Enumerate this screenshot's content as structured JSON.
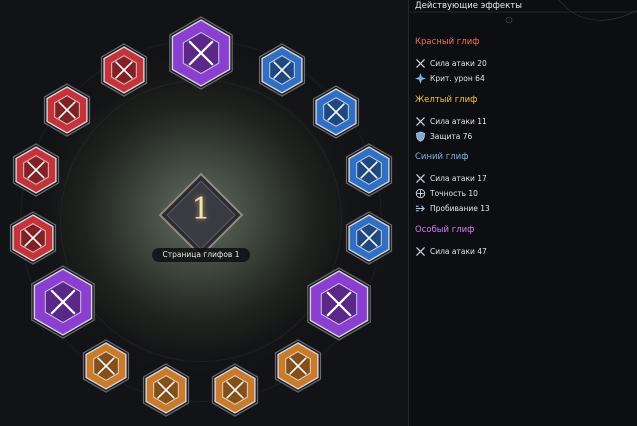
{
  "board": {
    "page_number": "1",
    "page_label": "Страница глифов 1",
    "glyphs": [
      {
        "name": "glyph-special-top",
        "color": "purple"
      },
      {
        "name": "glyph-blue-1",
        "color": "blue"
      },
      {
        "name": "glyph-blue-2",
        "color": "blue"
      },
      {
        "name": "glyph-blue-3",
        "color": "blue"
      },
      {
        "name": "glyph-blue-4",
        "color": "blue"
      },
      {
        "name": "glyph-special-right",
        "color": "purple"
      },
      {
        "name": "glyph-orange-1",
        "color": "orange"
      },
      {
        "name": "glyph-orange-2",
        "color": "orange"
      },
      {
        "name": "glyph-orange-3",
        "color": "orange"
      },
      {
        "name": "glyph-orange-4",
        "color": "orange"
      },
      {
        "name": "glyph-special-left",
        "color": "purple"
      },
      {
        "name": "glyph-red-1",
        "color": "red"
      },
      {
        "name": "glyph-red-2",
        "color": "red"
      },
      {
        "name": "glyph-red-3",
        "color": "red"
      },
      {
        "name": "glyph-red-4",
        "color": "red"
      }
    ],
    "colors": {
      "purple": "#8a3fd1",
      "blue": "#2f6fc4",
      "red": "#c4333a",
      "orange": "#c97a2a"
    }
  },
  "panel": {
    "title": "Действующие эффекты",
    "sections": [
      {
        "title": "Красный глиф",
        "color": "#f0705a",
        "stats": [
          {
            "icon": "swords-icon",
            "text": "Сила атаки 20"
          },
          {
            "icon": "crit-icon",
            "text": "Крит. урон 64"
          }
        ]
      },
      {
        "title": "Желтый глиф",
        "color": "#f2c44a",
        "stats": [
          {
            "icon": "swords-icon",
            "text": "Сила атаки 11"
          },
          {
            "icon": "shield-icon",
            "text": "Защита 76"
          }
        ]
      },
      {
        "title": "Синий глиф",
        "color": "#7fb0f0",
        "stats": [
          {
            "icon": "swords-icon",
            "text": "Сила атаки 17"
          },
          {
            "icon": "accuracy-icon",
            "text": "Точность 10"
          },
          {
            "icon": "penetration-icon",
            "text": "Пробивание 13"
          }
        ]
      },
      {
        "title": "Особый глиф",
        "color": "#d77cf2",
        "stats": [
          {
            "icon": "swords-icon",
            "text": "Сила атаки 47"
          }
        ]
      }
    ]
  }
}
